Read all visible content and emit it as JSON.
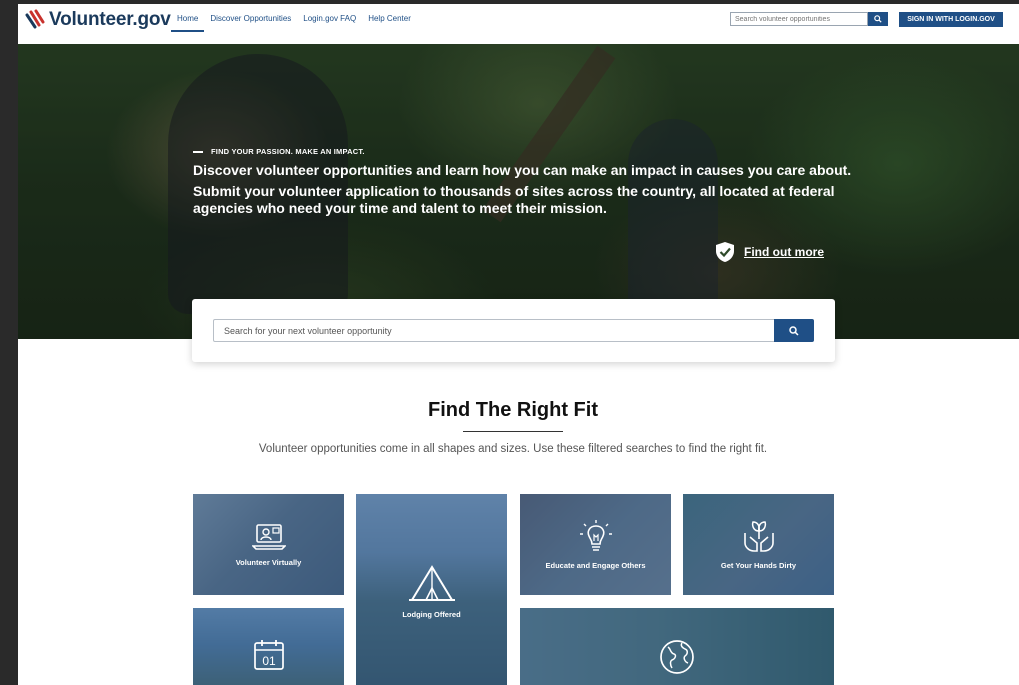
{
  "header": {
    "logo_text": "Volunteer.gov",
    "nav": [
      {
        "label": "Home",
        "active": true
      },
      {
        "label": "Discover Opportunities",
        "active": false
      },
      {
        "label": "Login.gov FAQ",
        "active": false
      },
      {
        "label": "Help Center",
        "active": false
      }
    ],
    "search_placeholder": "Search volunteer opportunities",
    "signin_label": "SIGN IN WITH LOGIN.GOV"
  },
  "hero": {
    "kicker": "FIND YOUR PASSION. MAKE AN IMPACT.",
    "line1": "Discover volunteer opportunities and learn how you can make an impact in causes you care about.",
    "line2": "Submit your volunteer application to thousands of sites across the country, all located at federal agencies who need your time and talent to meet their mission.",
    "find_more": "Find out more"
  },
  "main_search": {
    "placeholder": "Search for your next volunteer opportunity"
  },
  "fit": {
    "title": "Find The Right Fit",
    "description": "Volunteer opportunities come in all shapes and sizes. Use these filtered searches to find the right fit.",
    "tiles": [
      {
        "label": "Volunteer Virtually",
        "icon": "laptop-icon"
      },
      {
        "label": "Lodging Offered",
        "icon": "tent-icon"
      },
      {
        "label": "Educate and Engage Others",
        "icon": "lightbulb-icon"
      },
      {
        "label": "Get Your Hands Dirty",
        "icon": "plant-hands-icon"
      },
      {
        "label": "",
        "icon": "calendar-icon",
        "icon_text": "01"
      },
      {
        "label": "",
        "icon": "globe-icon"
      }
    ]
  },
  "colors": {
    "brand_blue": "#1f4f86",
    "logo_navy": "#1b3a5c",
    "logo_red": "#c8322d"
  }
}
